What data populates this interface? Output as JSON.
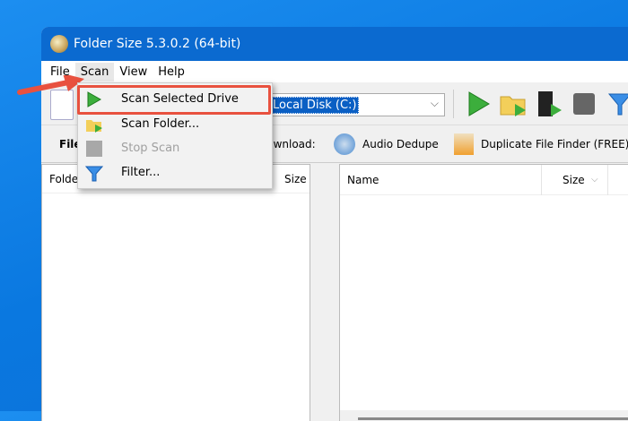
{
  "window": {
    "title": "Folder Size 5.3.0.2 (64-bit)"
  },
  "menubar": {
    "items": [
      "File",
      "Scan",
      "View",
      "Help"
    ]
  },
  "toolbar": {
    "drive_selected": "Local Disk (C:)"
  },
  "toolbar2": {
    "files_label": "File",
    "download_label": "Download:",
    "audio_dedupe": "Audio Dedupe",
    "duplicate_finder": "Duplicate File Finder (FREE)"
  },
  "left_pane": {
    "col_folder": "Folder",
    "col_size": "Size"
  },
  "right_pane": {
    "col_name": "Name",
    "col_size": "Size"
  },
  "scan_menu": {
    "items": [
      {
        "label": "Scan Selected Drive",
        "enabled": true
      },
      {
        "label": "Scan Folder...",
        "enabled": true
      },
      {
        "label": "Stop Scan",
        "enabled": false
      },
      {
        "label": "Filter...",
        "enabled": true
      }
    ]
  },
  "colors": {
    "title_bar": "#0b6ad0",
    "highlight": "#e8513f"
  }
}
